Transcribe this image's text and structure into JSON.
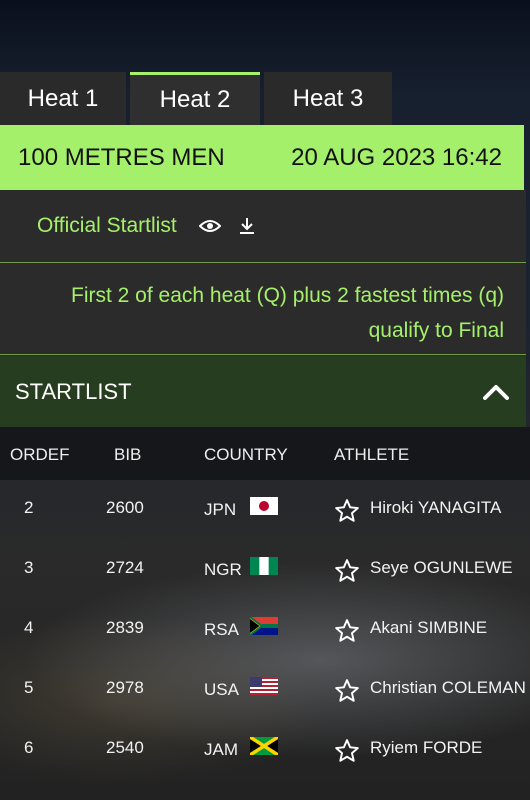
{
  "tabs": [
    {
      "label": "Heat 1",
      "active": false
    },
    {
      "label": "Heat 2",
      "active": true
    },
    {
      "label": "Heat 3",
      "active": false
    }
  ],
  "event": {
    "name": "100 METRES MEN",
    "datetime": "20 AUG 2023 16:42"
  },
  "startlist_link": {
    "label": "Official Startlist",
    "icons": [
      "eye-icon",
      "download-icon"
    ]
  },
  "qualification": {
    "line1": "First 2 of each heat (Q) plus 2 fastest times (q)",
    "line2": "qualify to Final"
  },
  "section": {
    "title": "STARTLIST",
    "toggle_icon": "chevron-up-icon"
  },
  "table": {
    "columns": [
      "ORDEF",
      "BIB",
      "COUNTRY",
      "ATHLETE"
    ],
    "rows": [
      {
        "order": "2",
        "bib": "2600",
        "country": "JPN",
        "athlete": "Hiroki YANAGITA"
      },
      {
        "order": "3",
        "bib": "2724",
        "country": "NGR",
        "athlete": "Seye OGUNLEWE"
      },
      {
        "order": "4",
        "bib": "2839",
        "country": "RSA",
        "athlete": "Akani SIMBINE"
      },
      {
        "order": "5",
        "bib": "2978",
        "country": "USA",
        "athlete": "Christian COLEMAN"
      },
      {
        "order": "6",
        "bib": "2540",
        "country": "JAM",
        "athlete": "Ryiem FORDE"
      }
    ]
  },
  "colors": {
    "accent": "#a5f06b",
    "header_dark_green": "#273d1f",
    "panel": "#2b2b2b"
  }
}
